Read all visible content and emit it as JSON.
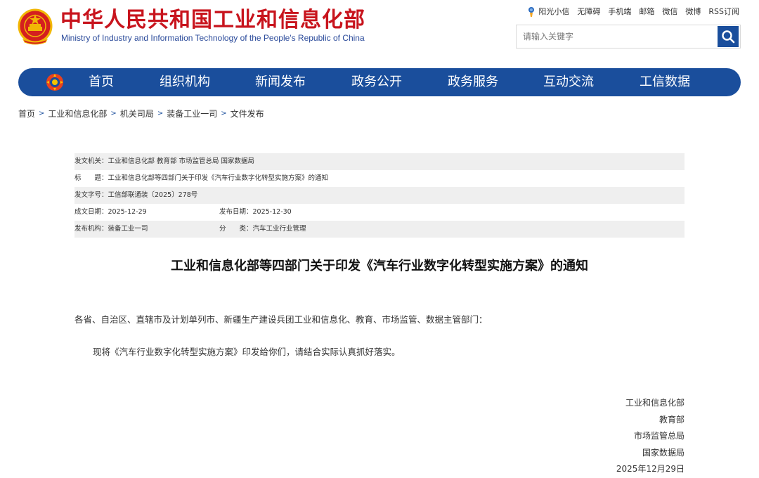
{
  "header": {
    "title_cn": "中华人民共和国工业和信息化部",
    "title_en": "Ministry of Industry and Information Technology of the People's Republic of China",
    "top_links": [
      "阳光小信",
      "无障碍",
      "手机端",
      "邮箱",
      "微信",
      "微博",
      "RSS订阅"
    ],
    "search_placeholder": "请输入关键字"
  },
  "nav": {
    "items": [
      "首页",
      "组织机构",
      "新闻发布",
      "政务公开",
      "政务服务",
      "互动交流",
      "工信数据"
    ]
  },
  "breadcrumb": [
    "首页",
    "工业和信息化部",
    "机关司局",
    "装备工业一司",
    "文件发布"
  ],
  "meta": {
    "issuer": "发文机关：工业和信息化部 教育部 市场监管总局 国家数据局",
    "title": "标　　题：工业和信息化部等四部门关于印发《汽车行业数字化转型实施方案》的通知",
    "doc_number": "发文字号：工信部联通装〔2025〕278号",
    "created_date": "成文日期：2025-12-29",
    "published_date": "发布日期：2025-12-30",
    "publisher": "发布机构：装备工业一司",
    "category": "分　　类：汽车工业行业管理"
  },
  "article": {
    "title": "工业和信息化部等四部门关于印发《汽车行业数字化转型实施方案》的通知",
    "recipients": "各省、自治区、直辖市及计划单列市、新疆生产建设兵团工业和信息化、教育、市场监管、数据主管部门：",
    "body": "现将《汽车行业数字化转型实施方案》印发给你们，请结合实际认真抓好落实。",
    "signatures": [
      "工业和信息化部",
      "教育部",
      "市场监管总局",
      "国家数据局"
    ],
    "date": "2025年12月29日"
  },
  "colors": {
    "brand_red": "#c8141d",
    "nav_blue": "#1a4e9c",
    "en_blue": "#2a4a9a",
    "meta_shade": "#efefef"
  },
  "icons": [
    "national-emblem-icon",
    "sun-icon",
    "search-icon",
    "nav-logo-icon",
    "chevron-right-icon"
  ]
}
